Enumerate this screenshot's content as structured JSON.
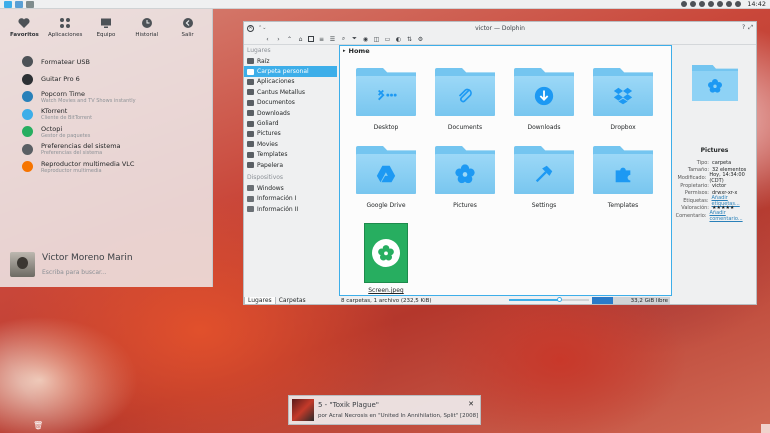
{
  "panel": {
    "clock": "14:42"
  },
  "kickoff": {
    "tabs": [
      {
        "label": "Favoritos"
      },
      {
        "label": "Aplicaciones"
      },
      {
        "label": "Equipo"
      },
      {
        "label": "Historial"
      },
      {
        "label": "Salir"
      }
    ],
    "apps": [
      {
        "name": "Formatear USB",
        "sub": "",
        "color": "#4d5257"
      },
      {
        "name": "Guitar Pro 6",
        "sub": "",
        "color": "#2c3034"
      },
      {
        "name": "Popcorn Time",
        "sub": "Watch Movies and TV Shows instantly",
        "color": "#2980b9"
      },
      {
        "name": "KTorrent",
        "sub": "Cliente de BitTorrent",
        "color": "#3daee9"
      },
      {
        "name": "Octopi",
        "sub": "Gestor de paquetes",
        "color": "#27ae60"
      },
      {
        "name": "Preferencias del sistema",
        "sub": "Preferencias del sistema",
        "color": "#5a5f64"
      },
      {
        "name": "Reproductor multimedia VLC",
        "sub": "Reproductor multimedia",
        "color": "#f67400"
      }
    ],
    "user": {
      "name": "Victor Moreno Marin",
      "search_placeholder": "Escriba para buscar..."
    }
  },
  "dolphin": {
    "title": "victor — Dolphin",
    "places_header": "Lugares",
    "places": [
      {
        "label": "Raíz"
      },
      {
        "label": "Carpeta personal"
      },
      {
        "label": "Aplicaciones"
      },
      {
        "label": "Cantus Metallus"
      },
      {
        "label": "Documentos"
      },
      {
        "label": "Downloads"
      },
      {
        "label": "Goliard"
      },
      {
        "label": "Pictures"
      },
      {
        "label": "Movies"
      },
      {
        "label": "Templates"
      },
      {
        "label": "Papelera"
      }
    ],
    "devices_header": "Dispositivos",
    "devices": [
      {
        "label": "Windows"
      },
      {
        "label": "Información I"
      },
      {
        "label": "Información II"
      }
    ],
    "panel_tabs": [
      "Lugares",
      "Carpetas"
    ],
    "breadcrumb": "Home",
    "items": [
      {
        "label": "Desktop",
        "icon": "dots-icon"
      },
      {
        "label": "Documents",
        "icon": "paperclip-icon"
      },
      {
        "label": "Downloads",
        "icon": "download-icon"
      },
      {
        "label": "Dropbox",
        "icon": "dropbox-icon"
      },
      {
        "label": "Google Drive",
        "icon": "drive-icon"
      },
      {
        "label": "Pictures",
        "icon": "flower-icon"
      },
      {
        "label": "Settings",
        "icon": "hammer-icon"
      },
      {
        "label": "Templates",
        "icon": "puzzle-icon"
      },
      {
        "label": "Screen.jpeg",
        "icon": "image-icon"
      }
    ],
    "info": {
      "title": "Pictures",
      "rows": [
        {
          "k": "Tipo:",
          "v": "carpeta"
        },
        {
          "k": "Tamaño:",
          "v": "32 elementos"
        },
        {
          "k": "Modificado:",
          "v": "Hoy, 14:34:00 (CDT)"
        },
        {
          "k": "Propietario:",
          "v": "victor"
        },
        {
          "k": "Permisos:",
          "v": "drwxr-xr-x"
        },
        {
          "k": "Etiquetas:",
          "v": "Añadir etiquetas..."
        },
        {
          "k": "Valoración:",
          "v": "★★★★★"
        },
        {
          "k": "Comentario:",
          "v": "Añadir comentario..."
        }
      ]
    },
    "status": {
      "summary": "8 carpetas, 1 archivo (232,5 KiB)",
      "free": "33,2 GiB libre",
      "zoom": 0.62,
      "used": 0.27
    }
  },
  "notification": {
    "title": "5 - \"Toxik Plague\"",
    "body": "por Acral Necrosis en \"United In Annihilation, Split\" [2008]"
  }
}
